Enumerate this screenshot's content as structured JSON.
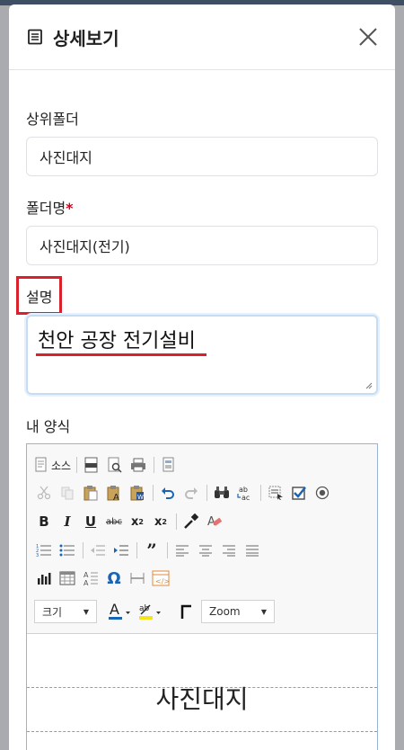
{
  "modal": {
    "title": "상세보기"
  },
  "form": {
    "parent_folder_label": "상위폴더",
    "parent_folder_value": "사진대지",
    "folder_name_label": "폴더명",
    "required_mark": "*",
    "folder_name_value": "사진대지(전기)",
    "description_label": "설명",
    "description_value": "천안 공장 전기설비",
    "my_form_label": "내 양식"
  },
  "editor": {
    "source_label": "소스",
    "size_combo": "크기",
    "zoom_combo": "Zoom",
    "document_title": "사진대지"
  },
  "colors": {
    "highlight": "#d9202b",
    "required": "#d0021b",
    "icon_blue": "#1a64b6"
  }
}
